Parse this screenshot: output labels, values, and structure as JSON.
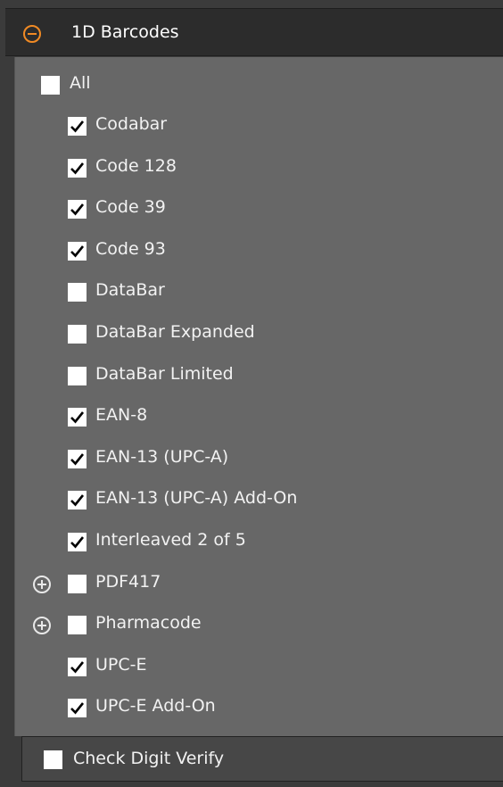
{
  "group": {
    "title": "1D Barcodes",
    "collapse_icon": "minus-circle-icon"
  },
  "all_option": {
    "label": "All",
    "checked": false
  },
  "symbologies": [
    {
      "label": "Codabar",
      "checked": true,
      "expandable": false
    },
    {
      "label": "Code 128",
      "checked": true,
      "expandable": false
    },
    {
      "label": "Code 39",
      "checked": true,
      "expandable": false
    },
    {
      "label": "Code 93",
      "checked": true,
      "expandable": false
    },
    {
      "label": "DataBar",
      "checked": false,
      "expandable": false
    },
    {
      "label": "DataBar Expanded",
      "checked": false,
      "expandable": false
    },
    {
      "label": "DataBar Limited",
      "checked": false,
      "expandable": false
    },
    {
      "label": "EAN-8",
      "checked": true,
      "expandable": false
    },
    {
      "label": "EAN-13 (UPC-A)",
      "checked": true,
      "expandable": false
    },
    {
      "label": "EAN-13 (UPC-A) Add-On",
      "checked": true,
      "expandable": false
    },
    {
      "label": "Interleaved 2 of 5",
      "checked": true,
      "expandable": false
    },
    {
      "label": "PDF417",
      "checked": false,
      "expandable": true
    },
    {
      "label": "Pharmacode",
      "checked": false,
      "expandable": true
    },
    {
      "label": "UPC-E",
      "checked": true,
      "expandable": false
    },
    {
      "label": "UPC-E Add-On",
      "checked": true,
      "expandable": false
    }
  ],
  "check_digit": {
    "label": "Check Digit Verify",
    "checked": false
  },
  "colors": {
    "accent": "#f08a24",
    "panel_bg": "#676767",
    "header_bg": "#2c2c2c"
  }
}
